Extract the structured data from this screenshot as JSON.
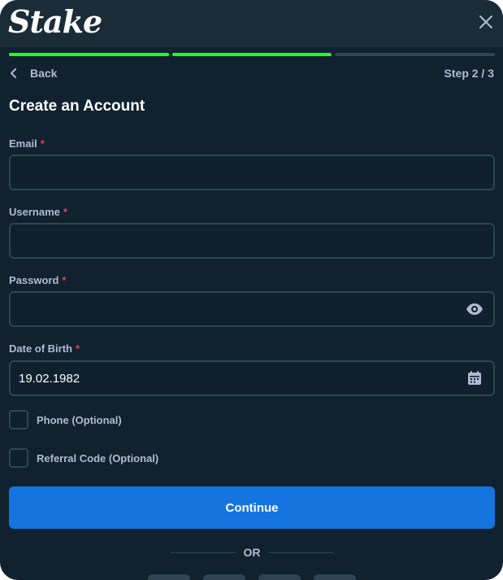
{
  "header": {
    "logo_text": "Stake",
    "close_icon": "close-icon"
  },
  "progress": {
    "total_steps": 3,
    "completed_steps": 2,
    "active_color": "#1fff20",
    "inactive_color": "#2f4553"
  },
  "nav": {
    "back_label": "Back",
    "step_label": "Step 2 / 3"
  },
  "form": {
    "title": "Create an Account",
    "required_mark": "*",
    "email": {
      "label": "Email",
      "value": ""
    },
    "username": {
      "label": "Username",
      "value": ""
    },
    "password": {
      "label": "Password",
      "value": "",
      "icon": "eye-icon"
    },
    "dob": {
      "label": "Date of Birth",
      "value": "19.02.1982",
      "icon": "calendar-icon"
    },
    "phone_label": "Phone (Optional)",
    "referral_label": "Referral Code (Optional)",
    "continue_label": "Continue"
  },
  "divider": {
    "or_label": "OR"
  },
  "colors": {
    "background": "#102230",
    "header": "#1a2c38",
    "border": "#2f4553",
    "primary_button": "#1475e1",
    "required": "#e53b54",
    "muted_text": "#b1bad3"
  }
}
